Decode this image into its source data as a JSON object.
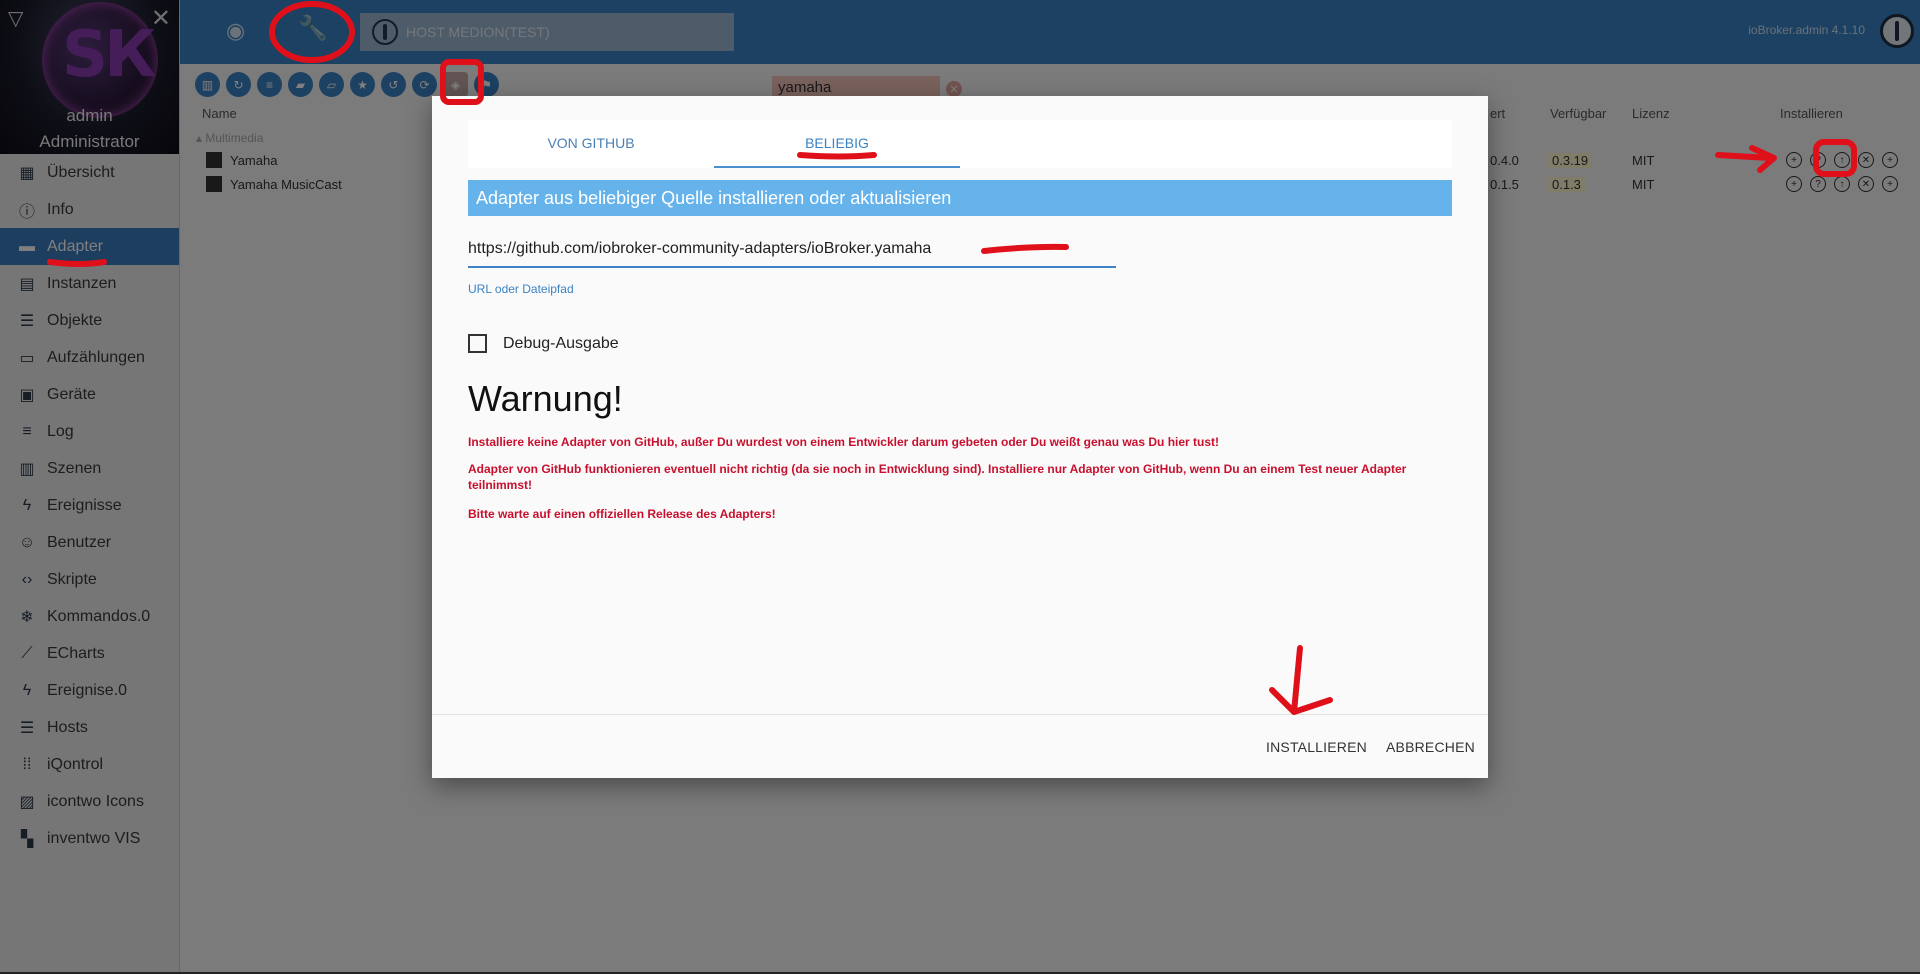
{
  "sidebar": {
    "user": "admin",
    "role": "Administrator",
    "items": [
      {
        "label": "Übersicht",
        "icon": "grid-icon"
      },
      {
        "label": "Info",
        "icon": "info-icon"
      },
      {
        "label": "Adapter",
        "icon": "store-icon",
        "active": true
      },
      {
        "label": "Instanzen",
        "icon": "instances-icon"
      },
      {
        "label": "Objekte",
        "icon": "list-icon"
      },
      {
        "label": "Aufzählungen",
        "icon": "enum-icon"
      },
      {
        "label": "Geräte",
        "icon": "devices-icon"
      },
      {
        "label": "Log",
        "icon": "log-icon"
      },
      {
        "label": "Szenen",
        "icon": "scenes-icon"
      },
      {
        "label": "Ereignisse",
        "icon": "flash-icon"
      },
      {
        "label": "Benutzer",
        "icon": "user-icon"
      },
      {
        "label": "Skripte",
        "icon": "code-icon"
      },
      {
        "label": "Kommandos.0",
        "icon": "snowflake-icon"
      },
      {
        "label": "ECharts",
        "icon": "chart-icon"
      },
      {
        "label": "Ereignise.0",
        "icon": "flash-icon"
      },
      {
        "label": "Hosts",
        "icon": "hosts-icon"
      },
      {
        "label": "iQontrol",
        "icon": "dots-grid-icon"
      },
      {
        "label": "icontwo Icons",
        "icon": "image-icon"
      },
      {
        "label": "inventwo VIS",
        "icon": "dashboard-icon"
      }
    ]
  },
  "topbar": {
    "host_label": "HOST MEDION(TEST)",
    "version": "ioBroker.admin 4.1.10"
  },
  "content": {
    "search_value": "yamaha",
    "columns": {
      "name": "Name",
      "installed": "ert",
      "available": "Verfügbar",
      "license": "Lizenz",
      "install": "Installieren"
    },
    "group": "Multimedia",
    "rows": [
      {
        "name": "Yamaha",
        "installed": "0.4.0",
        "available": "0.3.19",
        "license": "MIT"
      },
      {
        "name": "Yamaha MusicCast",
        "installed": "0.1.5",
        "available": "0.1.3",
        "license": "MIT"
      }
    ]
  },
  "dialog": {
    "tabs": [
      "VON GITHUB",
      "BELIEBIG"
    ],
    "active_tab": "BELIEBIG",
    "banner": "Adapter aus beliebiger Quelle installieren oder aktualisieren",
    "url_value": "https://github.com/iobroker-community-adapters/ioBroker.yamaha",
    "url_helper": "URL oder Dateipfad",
    "debug_label": "Debug-Ausgabe",
    "warning_title": "Warnung!",
    "warnings": [
      "Installiere keine Adapter von GitHub, außer Du wurdest von einem Entwickler darum gebeten oder Du weißt genau was Du hier tust!",
      "Adapter von GitHub funktionieren eventuell nicht richtig (da sie noch in Entwicklung sind). Installiere nur Adapter von GitHub, wenn Du an einem Test neuer Adapter teilnimmst!",
      "Bitte warte auf einen offiziellen Release des Adapters!"
    ],
    "install_label": "INSTALLIEREN",
    "cancel_label": "ABBRECHEN"
  },
  "colors": {
    "accent": "#3b83c4",
    "banner": "#66b3ec",
    "warning": "#c8102e",
    "annotation": "#e0101a"
  }
}
